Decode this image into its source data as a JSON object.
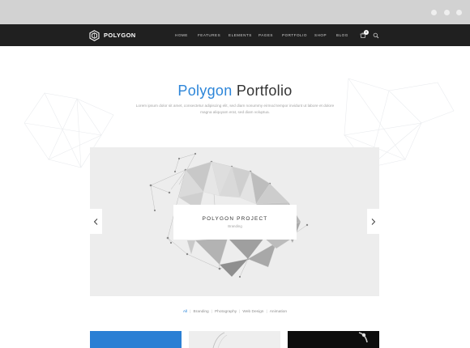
{
  "brand": {
    "name": "POLYGON",
    "icon": "polygon-logo-icon"
  },
  "nav": {
    "items": [
      "HOME",
      "FEATURES",
      "ELEMENTS",
      "PAGES",
      "PORTFOLIO",
      "SHOP",
      "BLOG"
    ],
    "cart_count": "0"
  },
  "hero": {
    "title_accent": "Polygon",
    "title_rest": " Portfolio",
    "description": "Lorem ipsum dolor sit amet, consectetur adipiscing elit, sed diam nonummy eirmod tempor invidunt ut labore et dolore magna aliquyam erat, sed diam voluptua."
  },
  "slider": {
    "caption_title": "POLYGON PROJECT",
    "caption_sub": "Branding"
  },
  "filters": [
    "All",
    "Branding",
    "Photography",
    "Web Design",
    "Animation"
  ],
  "colors": {
    "accent": "#2d86d9",
    "navbar": "#202020",
    "browser_bar": "#d2d2d2"
  }
}
